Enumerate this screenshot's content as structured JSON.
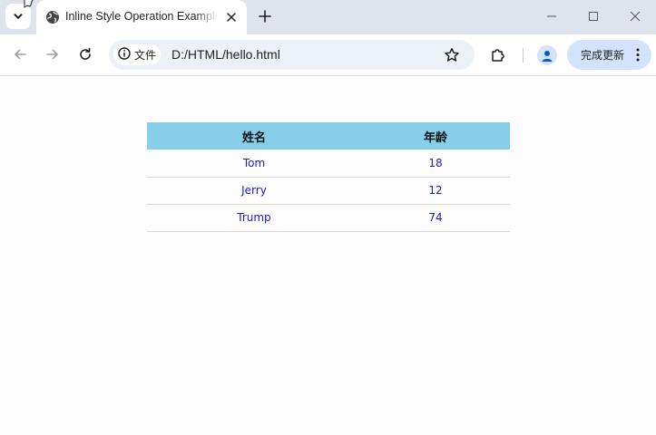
{
  "browser": {
    "tab": {
      "title": "Inline Style Operation Example",
      "favicon": "globe-icon"
    },
    "address_bar": {
      "site_chip_label": "文件",
      "url": "D:/HTML/hello.html"
    },
    "update_button_label": "完成更新",
    "colors": {
      "tabbar_bg": "#dfe3eb",
      "omnibox_bg": "#ecf0f7",
      "update_button_bg": "#d3e3fd"
    }
  },
  "page": {
    "table": {
      "headers": [
        "姓名",
        "年龄"
      ],
      "rows": [
        [
          "Tom",
          "18"
        ],
        [
          "Jerry",
          "12"
        ],
        [
          "Trump",
          "74"
        ]
      ],
      "colors": {
        "header_bg": "#87ceeb",
        "cell_text": "#1a1acd"
      }
    }
  }
}
